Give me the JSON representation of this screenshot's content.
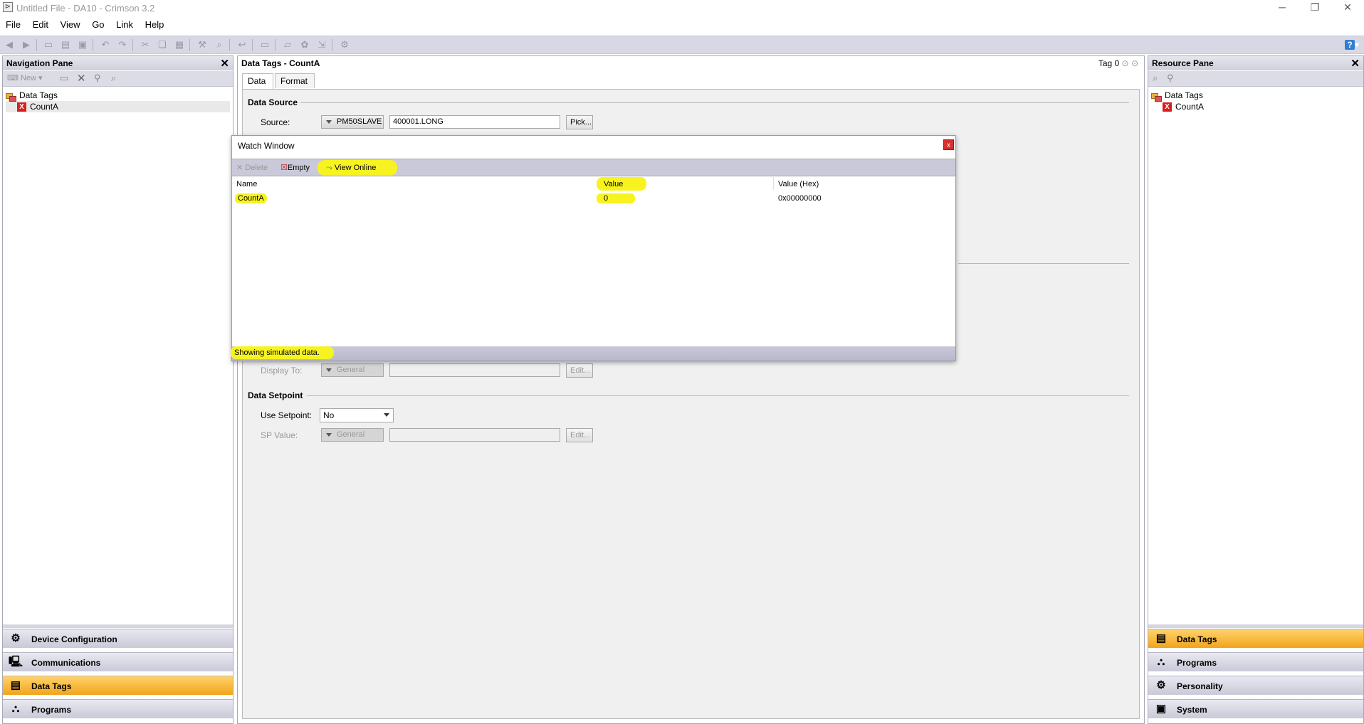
{
  "window": {
    "title": "Untitled File - DA10 - Crimson 3.2"
  },
  "menu": {
    "items": [
      "File",
      "Edit",
      "View",
      "Go",
      "Link",
      "Help"
    ]
  },
  "nav_pane": {
    "title": "Navigation Pane",
    "toolbar_new": "New",
    "tree": {
      "root": "Data Tags",
      "child": "CountA"
    },
    "sections": [
      {
        "label": "Device Configuration",
        "icon": "gear-icon",
        "active": false
      },
      {
        "label": "Communications",
        "icon": "monitor-icon",
        "active": false
      },
      {
        "label": "Data Tags",
        "icon": "data-tags-icon",
        "active": true
      },
      {
        "label": "Programs",
        "icon": "programs-icon",
        "active": false
      }
    ]
  },
  "center": {
    "title": "Data Tags - CountA",
    "tag_indicator": "Tag 0",
    "tabs": [
      "Data",
      "Format"
    ],
    "data_source": {
      "heading": "Data Source",
      "source_label": "Source:",
      "source_type": "PM50SLAVE",
      "source_value": "400001.LONG",
      "pick_label": "Pick..."
    },
    "display": {
      "display_to_label": "Display To:",
      "display_to_type": "General",
      "edit_label": "Edit..."
    },
    "data_setpoint": {
      "heading": "Data Setpoint",
      "use_setpoint_label": "Use Setpoint:",
      "use_setpoint_value": "No",
      "sp_value_label": "SP Value:",
      "sp_type": "General",
      "edit_label": "Edit..."
    }
  },
  "watch_window": {
    "title": "Watch Window",
    "close": "x",
    "toolbar": {
      "delete": "Delete",
      "empty": "Empty",
      "view_online": "View Online"
    },
    "columns": [
      "Name",
      "Value",
      "Value (Hex)"
    ],
    "rows": [
      {
        "name": "CountA",
        "value": "0",
        "hex": "0x00000000"
      }
    ],
    "status": "Showing simulated data."
  },
  "resource_pane": {
    "title": "Resource Pane",
    "tree": {
      "root": "Data Tags",
      "child": "CountA"
    },
    "sections": [
      {
        "label": "Data Tags",
        "icon": "data-tags-icon",
        "active": true
      },
      {
        "label": "Programs",
        "icon": "programs-icon",
        "active": false
      },
      {
        "label": "Personality",
        "icon": "gear-icon",
        "active": false
      },
      {
        "label": "System",
        "icon": "system-icon",
        "active": false
      }
    ]
  },
  "colors": {
    "highlight": "#f7f321",
    "active_section": "#f1a41c",
    "pane_header": "#d8d8e4"
  }
}
